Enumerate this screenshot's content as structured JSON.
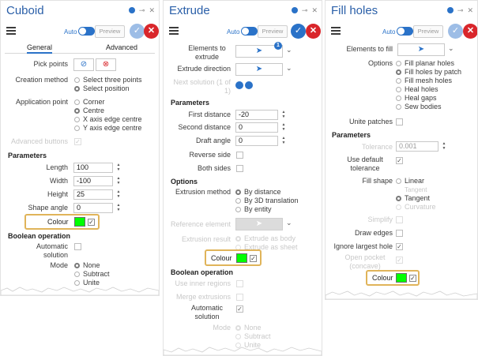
{
  "colors": {
    "accent": "#2a72c8",
    "title": "#2a5fa8",
    "cancel": "#d9262b",
    "highlight": "#e0b45a",
    "swatch": "#00ff00"
  },
  "toolbar": {
    "auto_label": "Auto",
    "preview_label": "Preview"
  },
  "cuboid": {
    "title": "Cuboid",
    "tabs": [
      "General",
      "Advanced"
    ],
    "pick_points": "Pick points",
    "creation_method": {
      "label": "Creation method",
      "options": [
        "Select three points",
        "Select position"
      ]
    },
    "application_point": {
      "label": "Application point",
      "options": [
        "Corner",
        "Centre",
        "X axis edge centre",
        "Y axis edge centre"
      ]
    },
    "advanced_buttons": "Advanced buttons",
    "parameters_header": "Parameters",
    "length": {
      "label": "Length",
      "value": "100"
    },
    "width": {
      "label": "Width",
      "value": "-100"
    },
    "height": {
      "label": "Height",
      "value": "25"
    },
    "shape_angle": {
      "label": "Shape angle",
      "value": "0"
    },
    "colour": "Colour",
    "boolean_header": "Boolean operation",
    "automatic_solution": "Automatic solution",
    "mode": {
      "label": "Mode",
      "options": [
        "None",
        "Subtract",
        "Unite"
      ]
    }
  },
  "extrude": {
    "title": "Extrude",
    "elements_to_extrude": "Elements to extrude",
    "badge_count": "1",
    "extrude_direction": "Extrude direction",
    "next_solution": "Next solution (1 of 1)",
    "parameters_header": "Parameters",
    "first_distance": {
      "label": "First distance",
      "value": "-20"
    },
    "second_distance": {
      "label": "Second distance",
      "value": "0"
    },
    "draft_angle": {
      "label": "Draft angle",
      "value": "0"
    },
    "reverse_side": "Reverse side",
    "both_sides": "Both sides",
    "options_header": "Options",
    "extrusion_method": {
      "label": "Extrusion method",
      "options": [
        "By distance",
        "By 3D translation",
        "By entity"
      ]
    },
    "reference_element": "Reference element",
    "extrusion_result": {
      "label": "Extrusion result",
      "options": [
        "Extrude as body",
        "Extrude as sheet"
      ]
    },
    "colour": "Colour",
    "boolean_header": "Boolean operation",
    "use_inner_regions": "Use inner regions",
    "merge_extrusions": "Merge extrusions",
    "automatic_solution": "Automatic solution",
    "mode": {
      "label": "Mode",
      "options": [
        "None",
        "Subtract",
        "Unite"
      ]
    }
  },
  "fill_holes": {
    "title": "Fill holes",
    "elements_to_fill": "Elements to fill",
    "options": {
      "label": "Options",
      "items": [
        "Fill planar holes",
        "Fill holes by patch",
        "Fill mesh holes",
        "Heal holes",
        "Heal gaps",
        "Sew bodies"
      ]
    },
    "unite_patches": "Unite patches",
    "parameters_header": "Parameters",
    "tolerance": {
      "label": "Tolerance",
      "value": "0.001"
    },
    "use_default_tolerance": "Use default tolerance",
    "fill_shape": {
      "label": "Fill shape",
      "options": [
        "Linear",
        "Tangent",
        "Curvature"
      ],
      "faded": "Tangent"
    },
    "simplify": "Simplify",
    "draw_edges": "Draw edges",
    "ignore_largest_hole": "Ignore largest hole",
    "open_pocket": "Open pocket (concave)",
    "colour": "Colour"
  }
}
